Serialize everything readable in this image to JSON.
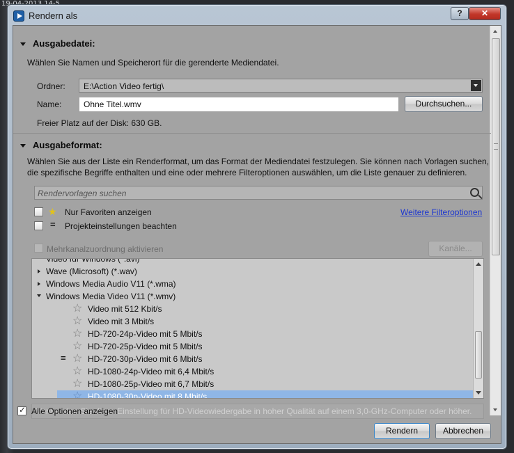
{
  "background": {
    "text": "19-04-2013 14-5..."
  },
  "window": {
    "title": "Rendern als",
    "help_label": "?",
    "close_label": "✕"
  },
  "output_file": {
    "heading": "Ausgabedatei:",
    "description": "Wählen Sie Namen und Speicherort für die gerenderte Mediendatei.",
    "folder_label": "Ordner:",
    "folder_value": "E:\\Action Video fertig\\",
    "name_label": "Name:",
    "name_value": "Ohne Titel.wmv",
    "browse_label": "Durchsuchen...",
    "free_space": "Freier Platz auf der Disk: 630 GB."
  },
  "output_format": {
    "heading": "Ausgabeformat:",
    "description_line1": "Wählen Sie aus der Liste ein Renderformat, um das Format der Mediendatei festzulegen. Sie können nach Vorlagen suchen,",
    "description_line2": "die spezifische Begriffe enthalten und eine oder mehrere Filteroptionen auswählen, um die Liste genauer zu definieren.",
    "search_placeholder": "Rendervorlagen suchen",
    "favorites_label": "Nur Favoriten anzeigen",
    "project_settings_label": "Projekteinstellungen beachten",
    "more_filters_link": "Weitere Filteroptionen",
    "multichannel_label": "Mehrkanalzuordnung aktivieren",
    "channels_label": "Kanäle..."
  },
  "tree": {
    "partial_row": "Video für Windows (*.avi)",
    "groups": [
      {
        "label": "Wave (Microsoft) (*.wav)",
        "expanded": false
      },
      {
        "label": "Windows Media Audio V11 (*.wma)",
        "expanded": false
      },
      {
        "label": "Windows Media Video V11 (*.wmv)",
        "expanded": true
      }
    ],
    "templates": [
      {
        "label": "Video mit 512 Kbit/s",
        "equal": false,
        "selected": false
      },
      {
        "label": "Video mit 3 Mbit/s",
        "equal": false,
        "selected": false
      },
      {
        "label": "HD-720-24p-Video mit 5 Mbit/s",
        "equal": false,
        "selected": false
      },
      {
        "label": "HD-720-25p-Video mit 5 Mbit/s",
        "equal": false,
        "selected": false
      },
      {
        "label": "HD-720-30p-Video mit 6 Mbit/s",
        "equal": true,
        "selected": false
      },
      {
        "label": "HD-1080-24p-Video mit 6,4 Mbit/s",
        "equal": false,
        "selected": false
      },
      {
        "label": "HD-1080-25p-Video mit 6,7 Mbit/s",
        "equal": false,
        "selected": false
      },
      {
        "label": "HD-1080-30p-Video mit 8 Mbit/s",
        "equal": false,
        "selected": true
      }
    ]
  },
  "template_description": "Verwenden Sie diese Einstellung für HD-Videowiedergabe in hoher Qualität auf einem 3,0-GHz-Computer oder höher.",
  "footer": {
    "show_all_label": "Alle Optionen anzeigen",
    "render_label": "Rendern",
    "cancel_label": "Abbrechen"
  }
}
